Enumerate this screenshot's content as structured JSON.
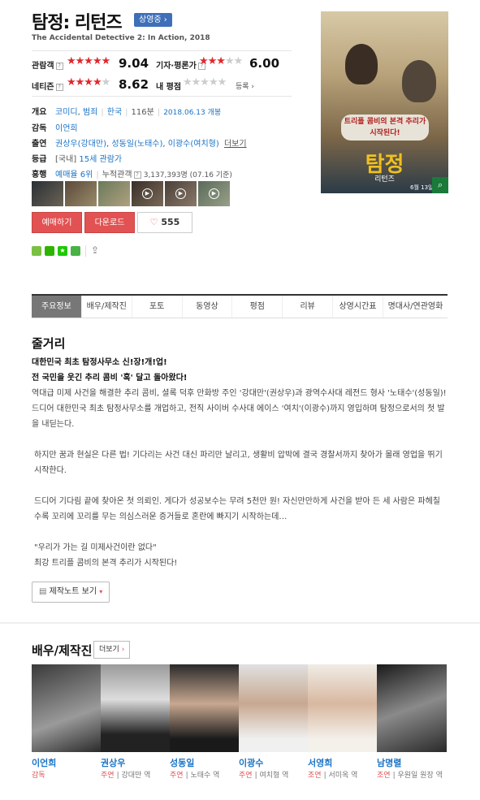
{
  "movie": {
    "title": "탐정: 리턴즈",
    "status_badge": "상영중",
    "english_title": "The Accidental Detective 2: In Action, 2018"
  },
  "ratings": {
    "audience_label": "관람객",
    "audience_score": "9.04",
    "audience_stars": 4.5,
    "critic_label": "기자·평론가",
    "critic_score": "6.00",
    "critic_stars": 3,
    "netizen_label": "네티즌",
    "netizen_score": "8.62",
    "netizen_stars": 4.3,
    "my_rating_label": "내 평점",
    "register_label": "등록"
  },
  "info": {
    "overview_label": "개요",
    "genres": [
      "코미디",
      "범죄"
    ],
    "country": "한국",
    "runtime": "116분",
    "release_date": "2018.06.13 개봉",
    "director_label": "감독",
    "director": "이언희",
    "cast_label": "출연",
    "cast": [
      "권상우(강대만)",
      "성동일(노태수)",
      "이광수(여치형)"
    ],
    "cast_more": "더보기",
    "grade_label": "등급",
    "grade_prefix": "[국내]",
    "grade": "15세 관람가",
    "box_label": "흥행",
    "reservation": "예매율 6위",
    "cumulative": "누적관객",
    "cumulative_value": "3,137,393명 (07.16 기준)"
  },
  "actions": {
    "reserve": "예매하기",
    "download": "다운로드",
    "likes": "555"
  },
  "tabs": [
    "주요정보",
    "배우/제작진",
    "포토",
    "동영상",
    "평점",
    "리뷰",
    "상영시간표",
    "명대사/연관영화"
  ],
  "synopsis": {
    "heading": "줄거리",
    "bold1": "대한민국 최초 탐정사무소 신!장!개!업!",
    "bold2": "전 국민을 웃긴 추리 콤비 '혹' 달고 돌아왔다!",
    "p1": "역대급 미제 사건을 해결한 추리 콤비, 셜록 덕후 만화방 주인 '강대만'(권상우)과 광역수사대 레전드 형사 '노태수'(성동일)! 드디어 대한민국 최초 탐정사무소를 개업하고, 전직 사이버 수사대 에이스 '여치'(이광수)까지 영입하며 탐정으로서의 첫 발을 내딛는다.",
    "p2": "하지만 꿈과 현실은 다른 법! 기다리는 사건 대신 파리만 날리고, 생활비 압박에 결국 경찰서까지 찾아가 몰래 영업을 뛰기 시작한다.",
    "p3": "드디어 기다림 끝에 찾아온 첫 의뢰인. 게다가 성공보수는 무려 5천만 원! 자신만만하게 사건을 받아 든 세 사람은 파헤칠수록 꼬리에 꼬리를 무는 의심스러운 증거들로 혼란에 빠지기 시작하는데…",
    "q1": "\"우리가 가는 길 미제사건이란 없다\"",
    "q2": "최강 트리플 콤비의 본격 추리가 시작된다!",
    "note_button": "제작노트 보기"
  },
  "cast_section": {
    "heading": "배우/제작진",
    "more": "더보기",
    "people": [
      {
        "name": "이언희",
        "role_kind": "감독",
        "role": ""
      },
      {
        "name": "권상우",
        "role_kind": "주연",
        "role": "강대만 역"
      },
      {
        "name": "성동일",
        "role_kind": "주연",
        "role": "노태수 역"
      },
      {
        "name": "이광수",
        "role_kind": "주연",
        "role": "여치형 역"
      },
      {
        "name": "서영희",
        "role_kind": "조연",
        "role": "서미옥 역"
      },
      {
        "name": "남명렬",
        "role_kind": "조연",
        "role": "우원일 원장 역"
      }
    ]
  },
  "poster": {
    "banner": "트리플 콤비의 본격 추리가 시작된다!",
    "title": "탐정",
    "subtitle": "리턴즈",
    "date": "6월 13일"
  },
  "colors": {
    "accent": "#e25252",
    "link": "#1a73c6",
    "badge": "#3e6fb8"
  }
}
